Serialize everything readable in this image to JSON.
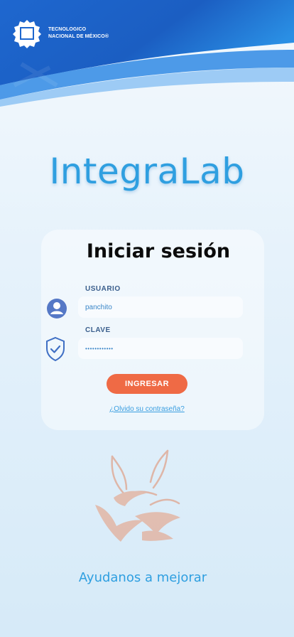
{
  "header": {
    "logo_line1": "TECNOLOGICO",
    "logo_line2": "NACIONAL DE MÉXICO®"
  },
  "app_title": "IntegraLab",
  "login": {
    "title": "Iniciar sesión",
    "user_label": "USUARIO",
    "user_value": "panchito",
    "password_label": "CLAVE",
    "password_value": "••••••••••••",
    "submit_label": "INGRESAR",
    "forgot_label": "¿Olvido su contraseña?"
  },
  "footer": {
    "feedback_label": "Ayudanos a mejorar"
  },
  "colors": {
    "primary": "#2f9fe0",
    "button": "#ef6a45",
    "header_dark": "#1a5fc7"
  }
}
